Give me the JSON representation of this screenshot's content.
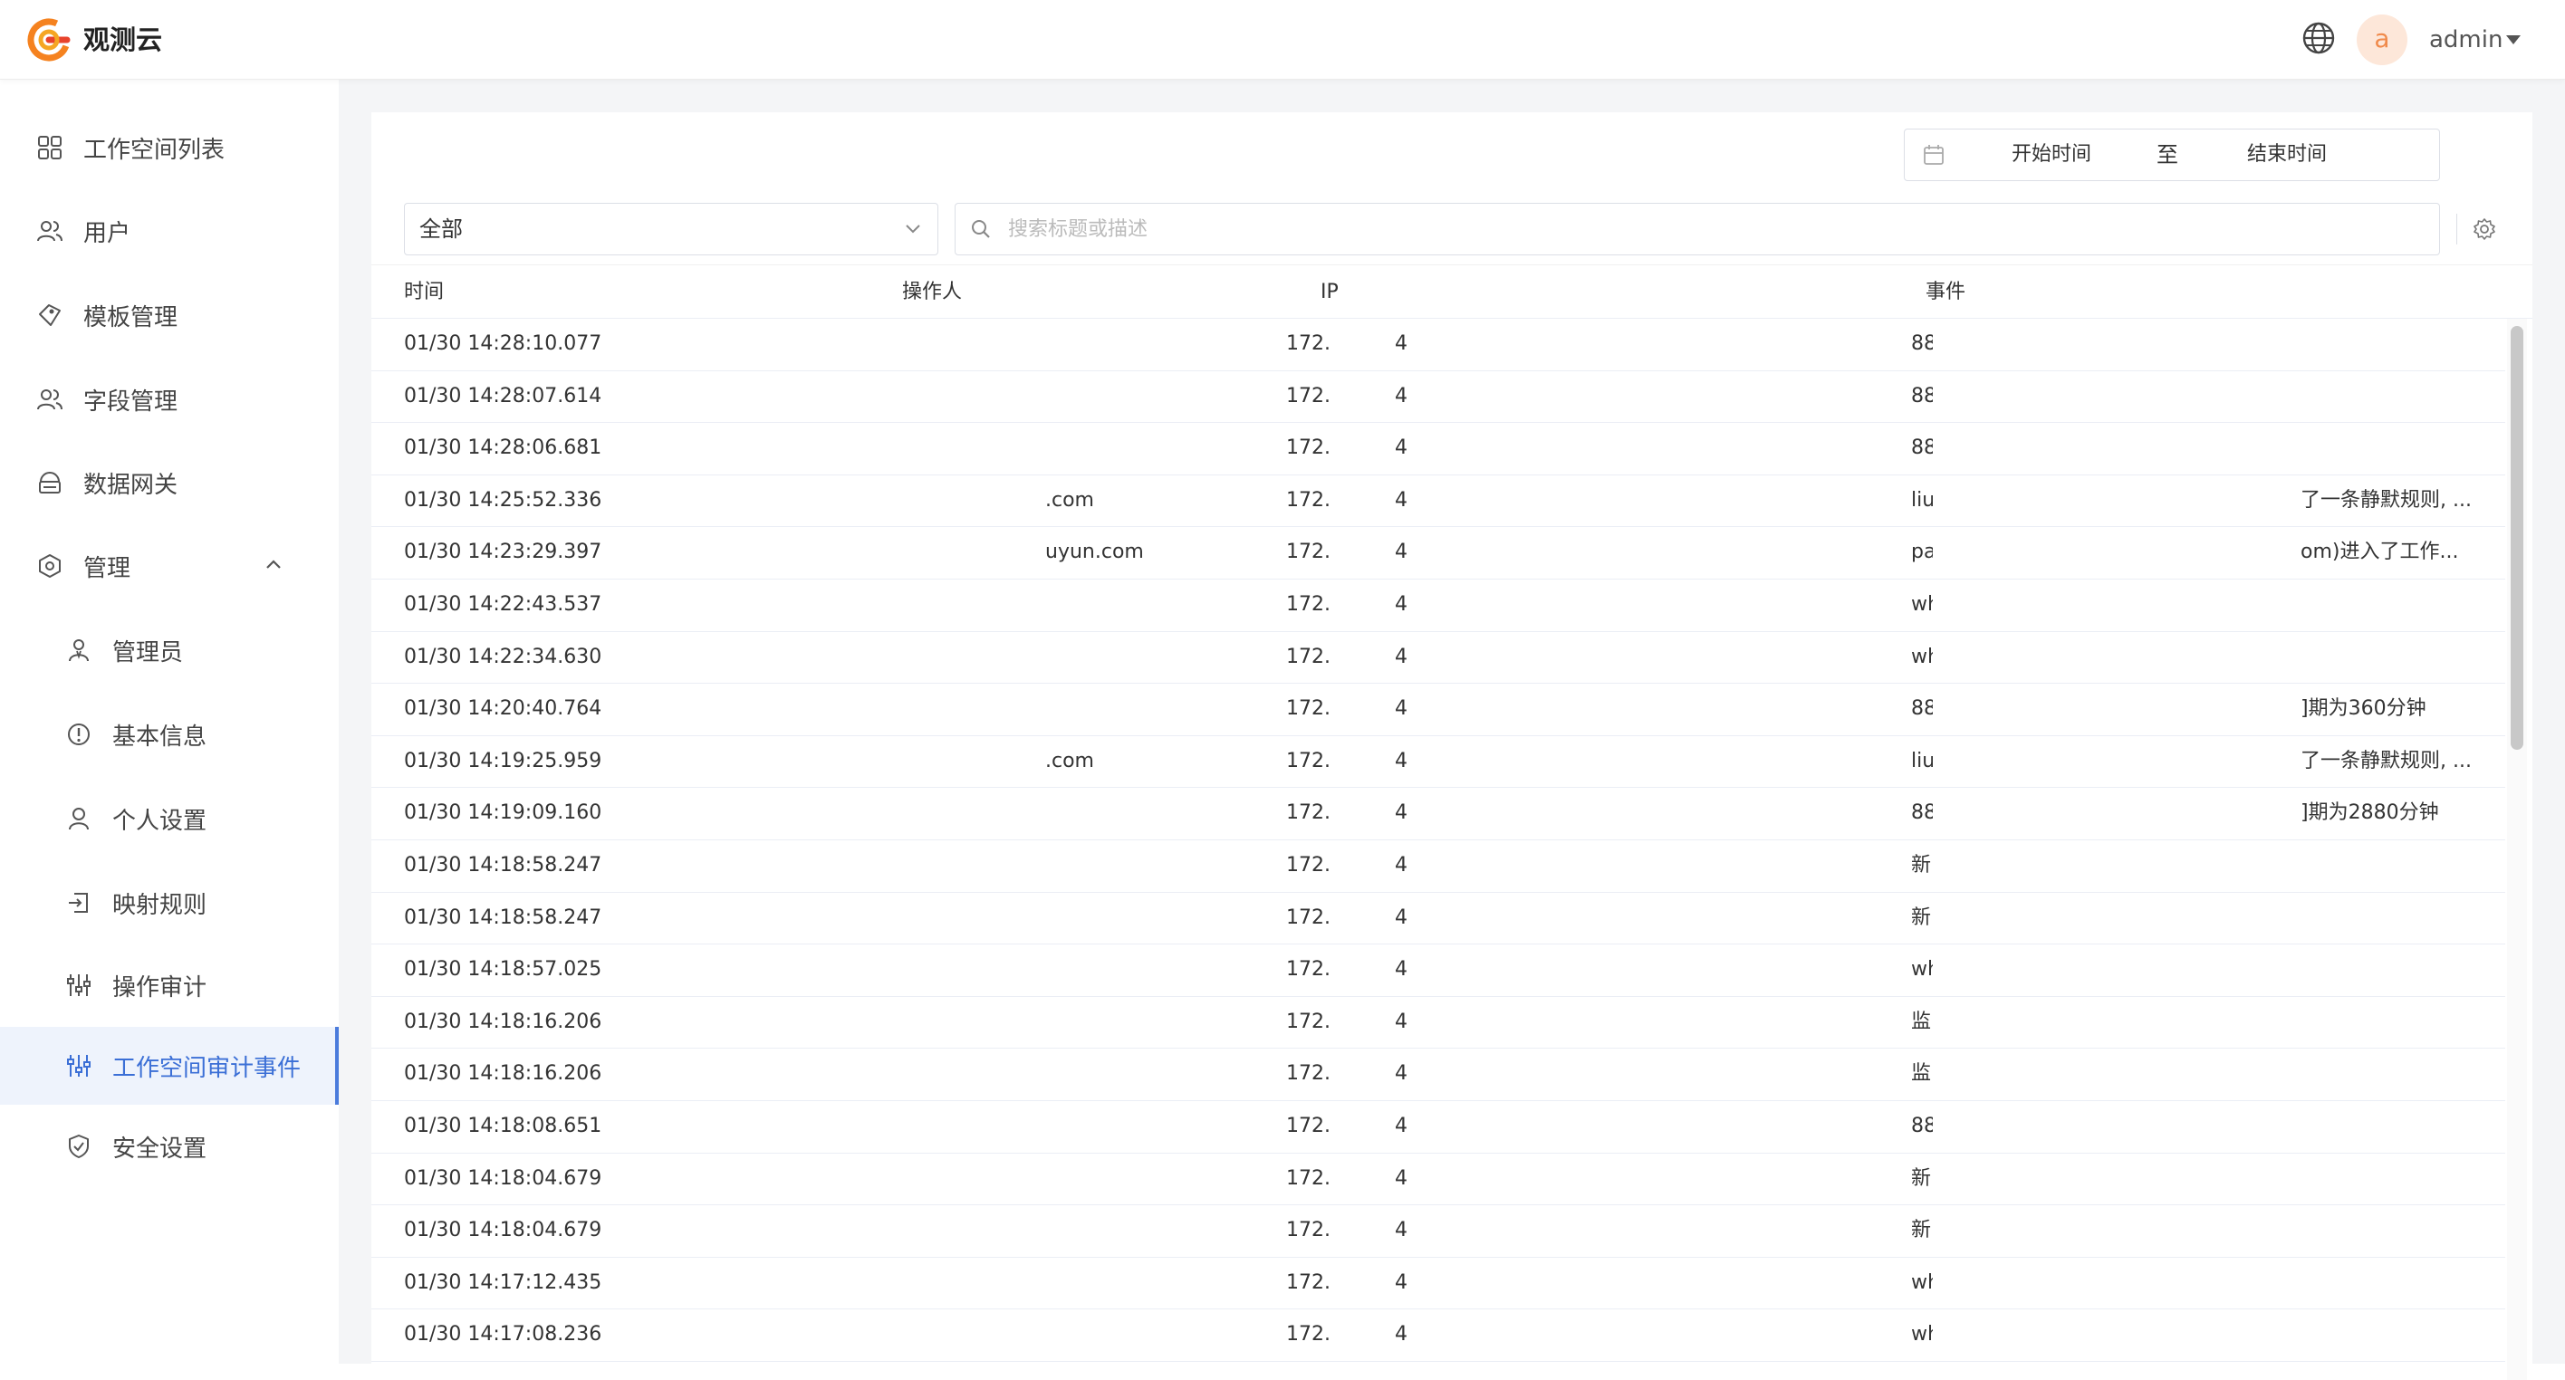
{
  "header": {
    "app_name": "观测云",
    "avatar_letter": "a",
    "username": "admin"
  },
  "sidebar": {
    "items": [
      {
        "label": "工作空间列表",
        "icon": "grid-icon"
      },
      {
        "label": "用户",
        "icon": "users-icon"
      },
      {
        "label": "模板管理",
        "icon": "template-icon"
      },
      {
        "label": "字段管理",
        "icon": "field-users-icon"
      },
      {
        "label": "数据网关",
        "icon": "gateway-icon"
      },
      {
        "label": "管理",
        "icon": "manage-icon",
        "expanded": true
      }
    ],
    "sub_items": [
      {
        "label": "管理员",
        "icon": "admin-icon"
      },
      {
        "label": "基本信息",
        "icon": "info-icon"
      },
      {
        "label": "个人设置",
        "icon": "person-icon"
      },
      {
        "label": "映射规则",
        "icon": "mapping-icon"
      },
      {
        "label": "操作审计",
        "icon": "sliders-icon"
      },
      {
        "label": "工作空间审计事件",
        "icon": "sliders-icon",
        "active": true
      },
      {
        "label": "安全设置",
        "icon": "shield-icon"
      }
    ]
  },
  "toolbar": {
    "date_start": "开始时间",
    "date_separator": "至",
    "date_end": "结束时间",
    "filter_value": "全部",
    "search_placeholder": "搜索标题或描述"
  },
  "table": {
    "columns": [
      "时间",
      "操作人",
      "IP",
      "事件"
    ],
    "rows": [
      {
        "time": "01/30 14:28:10.077",
        "operator": "",
        "ip": "172.",
        "ip_tail": "4",
        "event": "88",
        "desc": ""
      },
      {
        "time": "01/30 14:28:07.614",
        "operator": "",
        "ip": "172.",
        "ip_tail": "4",
        "event": "88",
        "desc": ""
      },
      {
        "time": "01/30 14:28:06.681",
        "operator": "",
        "ip": "172.",
        "ip_tail": "4",
        "event": "88",
        "desc": ""
      },
      {
        "time": "01/30 14:25:52.336",
        "operator": ".com",
        "ip": "172.",
        "ip_tail": "4",
        "event": "liu",
        "desc": "了一条静默规则, ..."
      },
      {
        "time": "01/30 14:23:29.397",
        "operator": "uyun.com",
        "ip": "172.",
        "ip_tail": "4",
        "event": "pa",
        "desc": "om)进入了工作..."
      },
      {
        "time": "01/30 14:22:43.537",
        "operator": "",
        "ip": "172.",
        "ip_tail": "4",
        "event": "wh",
        "desc": ""
      },
      {
        "time": "01/30 14:22:34.630",
        "operator": "",
        "ip": "172.",
        "ip_tail": "4",
        "event": "wh",
        "desc": ""
      },
      {
        "time": "01/30 14:20:40.764",
        "operator": "",
        "ip": "172.",
        "ip_tail": "4",
        "event": "88",
        "desc": "]期为360分钟"
      },
      {
        "time": "01/30 14:19:25.959",
        "operator": ".com",
        "ip": "172.",
        "ip_tail": "4",
        "event": "liu",
        "desc": "了一条静默规则, ..."
      },
      {
        "time": "01/30 14:19:09.160",
        "operator": "",
        "ip": "172.",
        "ip_tail": "4",
        "event": "88",
        "desc": "]期为2880分钟"
      },
      {
        "time": "01/30 14:18:58.247",
        "operator": "",
        "ip": "172.",
        "ip_tail": "4",
        "event": "新",
        "desc": ""
      },
      {
        "time": "01/30 14:18:58.247",
        "operator": "",
        "ip": "172.",
        "ip_tail": "4",
        "event": "新",
        "desc": ""
      },
      {
        "time": "01/30 14:18:57.025",
        "operator": "",
        "ip": "172.",
        "ip_tail": "4",
        "event": "wh",
        "desc": ""
      },
      {
        "time": "01/30 14:18:16.206",
        "operator": "",
        "ip": "172.",
        "ip_tail": "4",
        "event": "监",
        "desc": ""
      },
      {
        "time": "01/30 14:18:16.206",
        "operator": "",
        "ip": "172.",
        "ip_tail": "4",
        "event": "监",
        "desc": ""
      },
      {
        "time": "01/30 14:18:08.651",
        "operator": "",
        "ip": "172.",
        "ip_tail": "4",
        "event": "88",
        "desc": ""
      },
      {
        "time": "01/30 14:18:04.679",
        "operator": "",
        "ip": "172.",
        "ip_tail": "4",
        "event": "新",
        "desc": ""
      },
      {
        "time": "01/30 14:18:04.679",
        "operator": "",
        "ip": "172.",
        "ip_tail": "4",
        "event": "新",
        "desc": ""
      },
      {
        "time": "01/30 14:17:12.435",
        "operator": "",
        "ip": "172.",
        "ip_tail": "4",
        "event": "wh",
        "desc": ""
      },
      {
        "time": "01/30 14:17:08.236",
        "operator": "",
        "ip": "172.",
        "ip_tail": "4",
        "event": "wh",
        "desc": ""
      }
    ]
  },
  "colors": {
    "accent": "#4a7bdc",
    "active_bg": "#eef3fc",
    "logo_orange": "#f5821f",
    "avatar_bg": "#fde7d9"
  }
}
